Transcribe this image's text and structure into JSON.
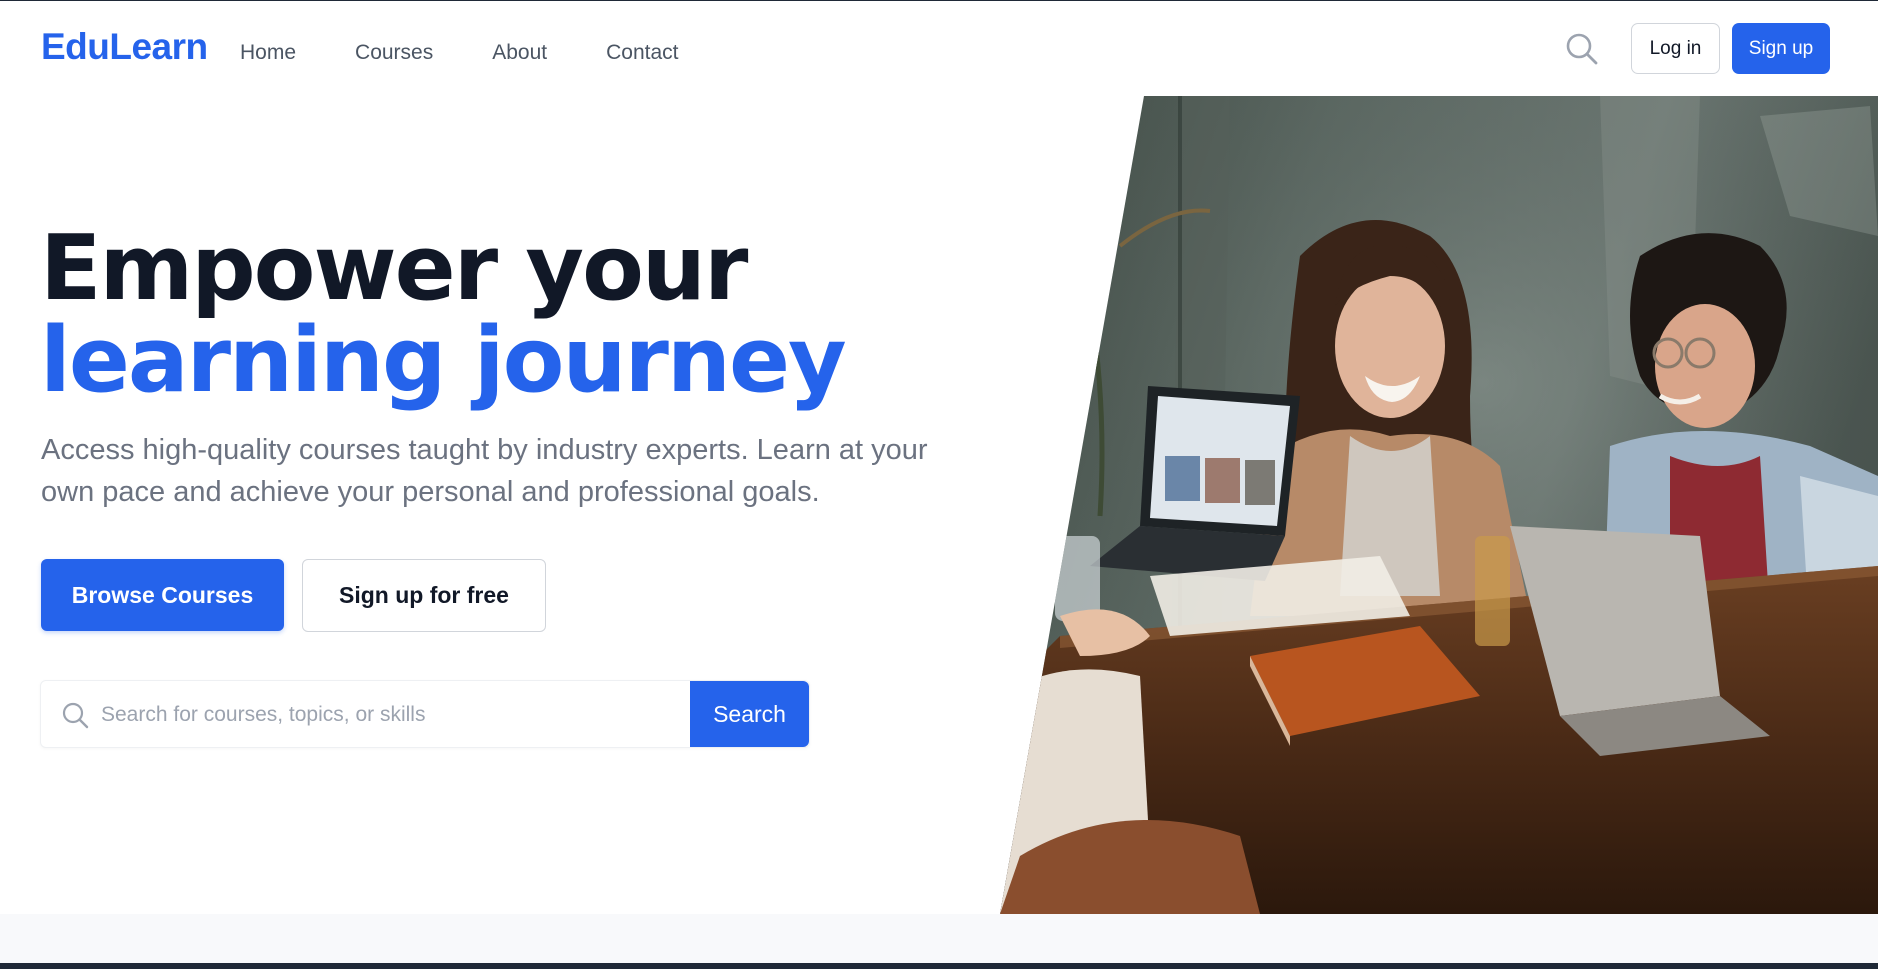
{
  "brand": {
    "name": "EduLearn",
    "accent": "#2563eb"
  },
  "nav": {
    "items": [
      {
        "label": "Home"
      },
      {
        "label": "Courses"
      },
      {
        "label": "About"
      },
      {
        "label": "Contact"
      }
    ]
  },
  "header_actions": {
    "search_icon": "search-icon",
    "login_label": "Log in",
    "signup_label": "Sign up"
  },
  "hero": {
    "headline_line1": "Empower your",
    "headline_line2": "learning journey",
    "subtext": "Access high-quality courses taught by industry experts. Learn at your own pace and achieve your personal and professional goals.",
    "primary_cta": "Browse Courses",
    "secondary_cta": "Sign up for free",
    "search": {
      "placeholder": "Search for courses, topics, or skills",
      "value": "",
      "button_label": "Search"
    }
  },
  "colors": {
    "headline_dark": "#111827",
    "text_muted": "#6b7280",
    "nav_text": "#4b5563"
  }
}
